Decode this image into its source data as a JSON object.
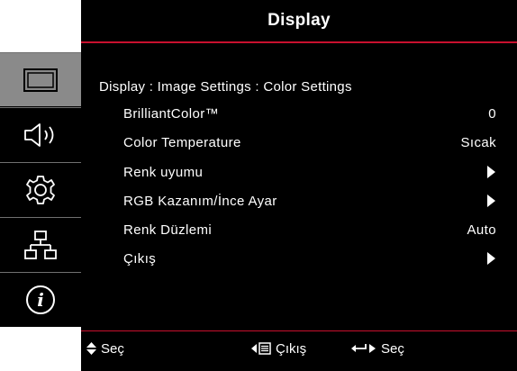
{
  "header": {
    "title": "Display"
  },
  "sidebar": {
    "tabs": [
      {
        "icon": "display-icon",
        "active": true
      },
      {
        "icon": "speaker-icon",
        "active": false
      },
      {
        "icon": "settings-gear-icon",
        "active": false
      },
      {
        "icon": "network-icon",
        "active": false
      },
      {
        "icon": "info-icon",
        "active": false
      }
    ]
  },
  "main": {
    "breadcrumb": "Display : Image Settings : Color Settings",
    "rows": [
      {
        "label": "BrilliantColor™",
        "value": "0"
      },
      {
        "label": "Color Temperature",
        "value": "Sıcak"
      },
      {
        "label": "Renk uyumu",
        "value": ""
      },
      {
        "label": "RGB Kazanım/İnce Ayar",
        "value": ""
      },
      {
        "label": "Renk Düzlemi",
        "value": "Auto"
      },
      {
        "label": "Çıkış",
        "value": ""
      }
    ]
  },
  "footer": {
    "select_label": "Seç",
    "exit_label": "Çıkış",
    "enter_label": "Seç"
  },
  "colors": {
    "accent": "#c8102e",
    "active_tab": "#8a8a8a",
    "background": "#000000"
  }
}
